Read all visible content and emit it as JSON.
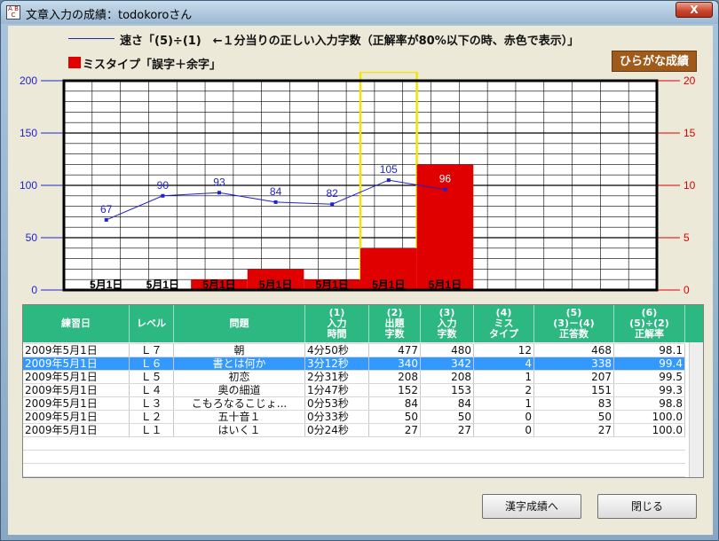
{
  "window": {
    "title": "文章入力の成績：todokoroさん",
    "close_label": "X",
    "icon_text": "A B C"
  },
  "legend": {
    "speed_text": "速さ「(5)÷(1)　←１分当りの正しい入力字数（正解率が80%以下の時、赤色で表示）」",
    "miss_text": "ミスタイプ「誤字＋余字」"
  },
  "hiragana_button": "ひらがな成績",
  "colors": {
    "speed_line": "#2222cc",
    "miss_bar": "#e00000",
    "highlight": "#f2e600",
    "header_bg": "#2db882",
    "selected_row": "#3399ff"
  },
  "chart_data": {
    "type": "bar+line",
    "categories": [
      "5月1日",
      "5月1日",
      "5月1日",
      "5月1日",
      "5月1日",
      "5月1日",
      "5月1日"
    ],
    "series": [
      {
        "values": [
          67,
          90,
          93,
          84,
          82,
          105,
          96
        ],
        "axis": "left"
      },
      {
        "values": [
          0,
          0,
          1,
          2,
          1,
          4,
          12
        ],
        "axis": "right"
      }
    ],
    "left_ticks": [
      "0",
      "50",
      "100",
      "150",
      "200"
    ],
    "right_ticks": [
      "0",
      "5",
      "10",
      "15",
      "20"
    ],
    "ylim_left": [
      0,
      200
    ],
    "ylim_right": [
      0,
      20
    ],
    "highlighted_index": 5,
    "grid": true
  },
  "table": {
    "headers": [
      "練習日",
      "レベル",
      "問題",
      "(1)\n入力\n時間",
      "(2)\n出題\n字数",
      "(3)\n入力\n字数",
      "(4)\nミス\nタイプ",
      "(5)\n(3)－(4)\n正答数",
      "(6)\n(5)÷(2)\n正解率"
    ],
    "rows": [
      [
        "2009年5月1日",
        "Ｌ７",
        "朝",
        "4分50秒",
        "477",
        "480",
        "12",
        "468",
        "98.1"
      ],
      [
        "2009年5月1日",
        "Ｌ６",
        "書とは何か",
        "3分12秒",
        "340",
        "342",
        "4",
        "338",
        "99.4"
      ],
      [
        "2009年5月1日",
        "Ｌ５",
        "初恋",
        "2分31秒",
        "208",
        "208",
        "1",
        "207",
        "99.5"
      ],
      [
        "2009年5月1日",
        "Ｌ４",
        "奥の細道",
        "1分47秒",
        "152",
        "153",
        "2",
        "151",
        "99.3"
      ],
      [
        "2009年5月1日",
        "Ｌ３",
        "こもろなるこじょ...",
        "0分53秒",
        "84",
        "84",
        "1",
        "83",
        "98.8"
      ],
      [
        "2009年5月1日",
        "Ｌ２",
        "五十音１",
        "0分33秒",
        "50",
        "50",
        "0",
        "50",
        "100.0"
      ],
      [
        "2009年5月1日",
        "Ｌ１",
        "はいく１",
        "0分24秒",
        "27",
        "27",
        "0",
        "27",
        "100.0"
      ]
    ],
    "selected_row": 1
  },
  "buttons": {
    "kanji": "漢字成績へ",
    "close": "閉じる"
  }
}
